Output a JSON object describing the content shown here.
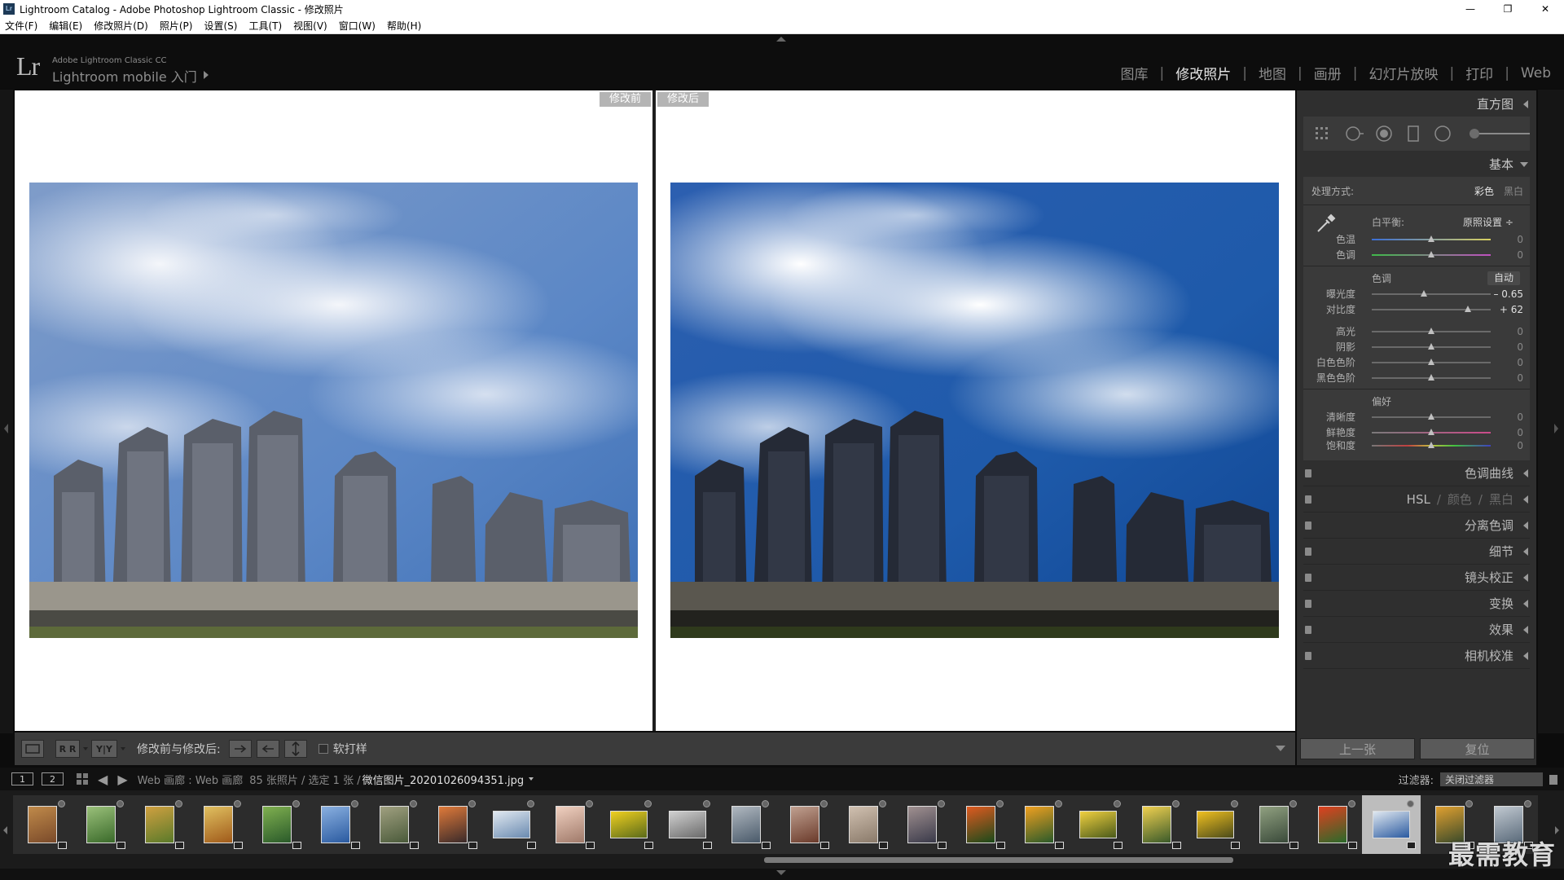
{
  "window": {
    "title": "Lightroom Catalog - Adobe Photoshop Lightroom Classic - 修改照片",
    "minimize": "—",
    "restore": "❐",
    "close": "✕"
  },
  "menu": [
    "文件(F)",
    "编辑(E)",
    "修改照片(D)",
    "照片(P)",
    "设置(S)",
    "工具(T)",
    "视图(V)",
    "窗口(W)",
    "帮助(H)"
  ],
  "identity": {
    "logo": "Lr",
    "line1": "Adobe Lightroom Classic CC",
    "line2": "Lightroom mobile 入门"
  },
  "modules": [
    {
      "label": "图库",
      "active": false
    },
    {
      "label": "修改照片",
      "active": true
    },
    {
      "label": "地图",
      "active": false
    },
    {
      "label": "画册",
      "active": false
    },
    {
      "label": "幻灯片放映",
      "active": false
    },
    {
      "label": "打印",
      "active": false
    },
    {
      "label": "Web",
      "active": false
    }
  ],
  "views": {
    "before_label": "修改前",
    "after_label": "修改后"
  },
  "toolbar": {
    "view_mode_label": "修改前与修改后:",
    "softproof_label": "软打样",
    "btn_ry": "R R",
    "btn_yy": "Y|Y"
  },
  "right_panel": {
    "histogram_title": "直方图",
    "basic_title": "基本",
    "treatment_label": "处理方式:",
    "treatment_color": "彩色",
    "treatment_bw": "黑白",
    "wb_label": "白平衡:",
    "wb_value": "原照设置 ÷",
    "temp_label": "色温",
    "temp_value": "0",
    "temp_pos": 0.5,
    "tint_label": "色调",
    "tint_value": "0",
    "tint_pos": 0.5,
    "tone_label": "色调",
    "auto_label": "自动",
    "exposure_label": "曝光度",
    "exposure_value": "– 0.65",
    "exposure_pos": 0.44,
    "contrast_label": "对比度",
    "contrast_value": "+ 62",
    "contrast_pos": 0.81,
    "highlights_label": "高光",
    "highlights_value": "0",
    "highlights_pos": 0.5,
    "shadows_label": "阴影",
    "shadows_value": "0",
    "shadows_pos": 0.5,
    "whites_label": "白色色阶",
    "whites_value": "0",
    "whites_pos": 0.5,
    "blacks_label": "黑色色阶",
    "blacks_value": "0",
    "blacks_pos": 0.5,
    "presence_label": "偏好",
    "clarity_label": "清晰度",
    "clarity_value": "0",
    "clarity_pos": 0.5,
    "vibrance_label": "鲜艳度",
    "vibrance_value": "0",
    "vibrance_pos": 0.5,
    "saturation_label": "饱和度",
    "saturation_value": "0",
    "saturation_pos": 0.5,
    "tone_curve": "色调曲线",
    "hsl": "HSL",
    "hsl_color": "颜色",
    "hsl_bw": "黑白",
    "split_toning": "分离色调",
    "detail": "细节",
    "lens": "镜头校正",
    "transform": "变换",
    "effects": "效果",
    "calibration": "相机校准",
    "prev_button": "上一张",
    "reset_button": "复位"
  },
  "filmstrip_header": {
    "monitor1": "1",
    "monitor2": "2",
    "source": "Web 画廊 : Web 画廊",
    "count": "85 张照片 / 选定 1 张 /",
    "filename": "微信图片_20201026094351.jpg",
    "filter_label": "过滤器:",
    "filter_value": "关闭过滤器"
  },
  "watermark": "最需教育",
  "colors": {
    "accent": "#e6e6e6",
    "panel": "#2f2f2f",
    "workspace": "#0d0d0d"
  }
}
